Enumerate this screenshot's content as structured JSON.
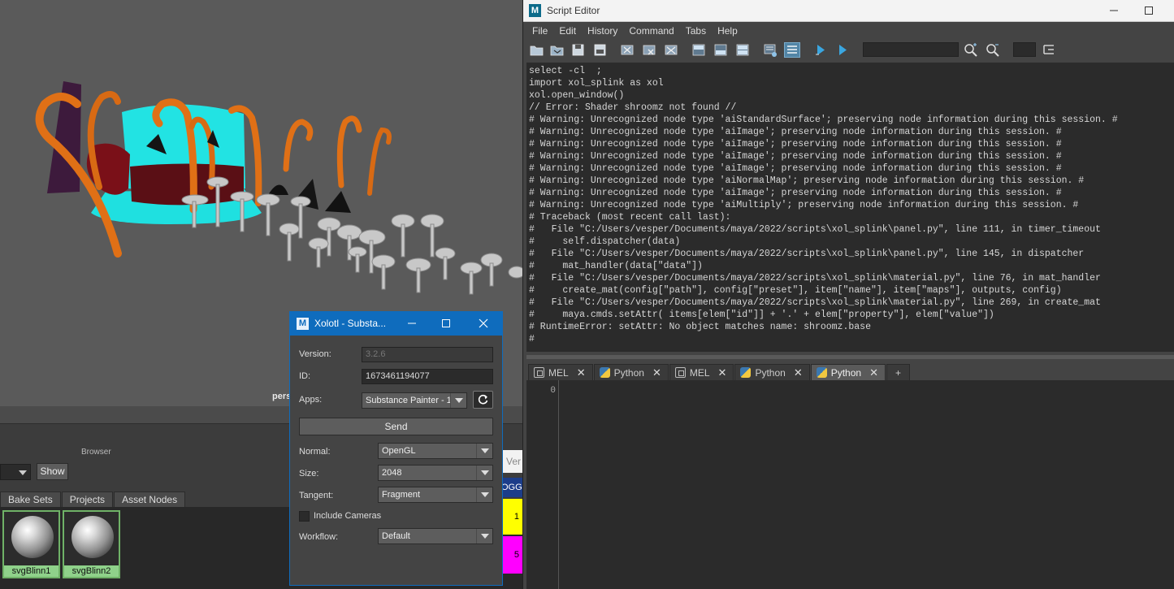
{
  "viewport": {
    "camera_label": "persp"
  },
  "lower": {
    "browser_label": "Browser",
    "show_button": "Show",
    "tabs": [
      "Bake Sets",
      "Projects",
      "Asset Nodes"
    ],
    "materials": [
      "svgBlinn1",
      "svgBlinn2"
    ],
    "side_labels": {
      "version_stub": "Ver",
      "logging_stub": "OGGI",
      "yellow_value": "1",
      "magenta_value": "5"
    },
    "colors": {
      "yellow": "#ffff00",
      "magenta": "#ff00ff",
      "material_green": "#8fd18a"
    }
  },
  "xolotl": {
    "title": "Xolotl - Substa...",
    "logo": "M",
    "icons": {
      "minimize": "minimize-icon",
      "maximize": "maximize-icon",
      "close": "close-icon",
      "refresh": "refresh-icon"
    },
    "version_label": "Version:",
    "version_value": "3.2.6",
    "id_label": "ID:",
    "id_value": "1673461194077",
    "apps_label": "Apps:",
    "apps_value": "Substance Painter - 1",
    "send_label": "Send",
    "normal_label": "Normal:",
    "normal_value": "OpenGL",
    "size_label": "Size:",
    "size_value": "2048",
    "tangent_label": "Tangent:",
    "tangent_value": "Fragment",
    "include_cameras_label": "Include Cameras",
    "workflow_label": "Workflow:",
    "workflow_value": "Default"
  },
  "script_editor": {
    "title": "Script Editor",
    "logo": "M",
    "menu": [
      "File",
      "Edit",
      "History",
      "Command",
      "Tabs",
      "Help"
    ],
    "history_lines": [
      "select -cl  ;",
      "import xol_splink as xol",
      "xol.open_window()",
      "// Error: Shader shroomz not found //",
      "# Warning: Unrecognized node type 'aiStandardSurface'; preserving node information during this session. #",
      "# Warning: Unrecognized node type 'aiImage'; preserving node information during this session. #",
      "# Warning: Unrecognized node type 'aiImage'; preserving node information during this session. #",
      "# Warning: Unrecognized node type 'aiImage'; preserving node information during this session. #",
      "# Warning: Unrecognized node type 'aiImage'; preserving node information during this session. #",
      "# Warning: Unrecognized node type 'aiNormalMap'; preserving node information during this session. #",
      "# Warning: Unrecognized node type 'aiImage'; preserving node information during this session. #",
      "# Warning: Unrecognized node type 'aiMultiply'; preserving node information during this session. #",
      "# Traceback (most recent call last):",
      "#   File \"C:/Users/vesper/Documents/maya/2022/scripts\\xol_splink\\panel.py\", line 111, in timer_timeout",
      "#     self.dispatcher(data)",
      "#   File \"C:/Users/vesper/Documents/maya/2022/scripts\\xol_splink\\panel.py\", line 145, in dispatcher",
      "#     mat_handler(data[\"data\"])",
      "#   File \"C:/Users/vesper/Documents/maya/2022/scripts\\xol_splink\\material.py\", line 76, in mat_handler",
      "#     create_mat(config[\"path\"], config[\"preset\"], item[\"name\"], item[\"maps\"], outputs, config)",
      "#   File \"C:/Users/vesper/Documents/maya/2022/scripts\\xol_splink\\material.py\", line 269, in create_mat",
      "#     maya.cmds.setAttr( items[elem[\"id\"]] + '.' + elem[\"property\"], elem[\"value\"])",
      "# RuntimeError: setAttr: No object matches name: shroomz.base",
      "#"
    ],
    "tabs": [
      {
        "kind": "mel",
        "label": "MEL",
        "active": false
      },
      {
        "kind": "py",
        "label": "Python",
        "active": false
      },
      {
        "kind": "mel",
        "label": "MEL",
        "active": false
      },
      {
        "kind": "py",
        "label": "Python",
        "active": false
      },
      {
        "kind": "py",
        "label": "Python",
        "active": true
      }
    ],
    "close_glyph": "✕",
    "add_tab_glyph": "+",
    "line_number": "0",
    "toolbar_icons": [
      "open-script-icon",
      "source-script-icon",
      "save-script-icon",
      "save-to-shelf-icon",
      "clear-history-icon",
      "clear-input-icon",
      "clear-all-icon",
      "show-history-icon",
      "show-input-icon",
      "show-both-icon",
      "echo-all-icon",
      "line-numbers-icon",
      "execute-all-icon",
      "execute-icon",
      "search-icon",
      "search-next-icon",
      "indent-icon"
    ]
  }
}
